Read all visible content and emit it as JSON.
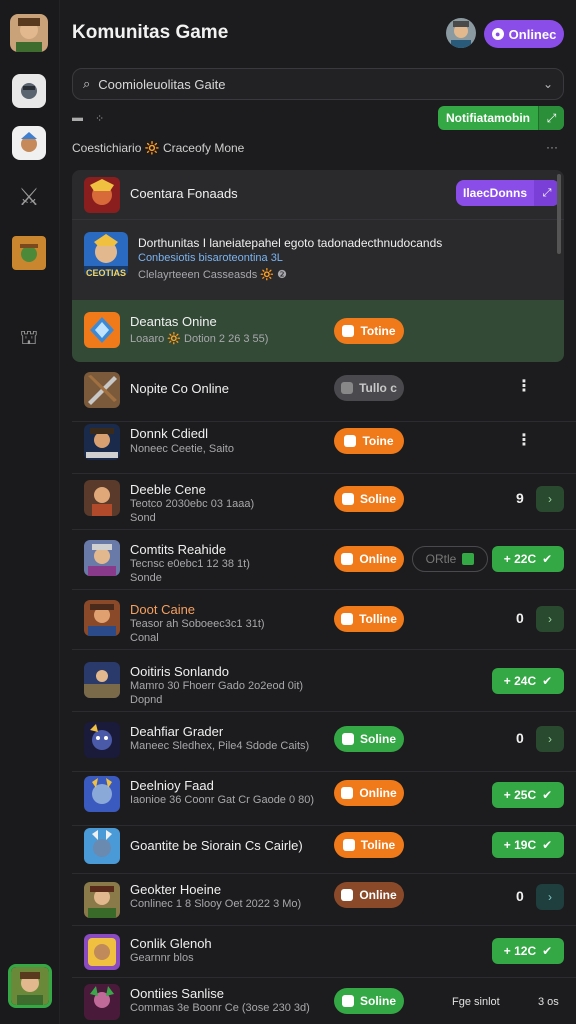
{
  "header": {
    "title": "Komunitas Game",
    "online_label": "Onlinec"
  },
  "search": {
    "value": "Coomioleuolitas Gaite"
  },
  "notif_button": {
    "label": "Notifiatamobin",
    "icon": "expand-icon"
  },
  "section": {
    "label": "Coestichiario 🔆 Craceofy Mone",
    "more": "···"
  },
  "panel": {
    "row1": {
      "title": "Coentara Fonaads",
      "button": "IlaecDonns"
    },
    "row2": {
      "title": "Dorthunitas  I laneiatepahel egoto tadonadecthnudocands",
      "line2": "Conbesiotis  bisaroteontina 3L",
      "line3": "Clelayrteeen Casseasds 🔆 ❷",
      "badge": "CEOTIAS"
    },
    "row3": {
      "title": "Deantas Onine",
      "sub": "Loaaro 🔆 Dotion 2 26 3 55)",
      "pill": "Totine"
    }
  },
  "rows": [
    {
      "title": "Nopite Co Online",
      "sub": "",
      "sub2": "",
      "pill": "Tullo c",
      "pill_style": "grey",
      "right": "dots"
    },
    {
      "title": "Donnk Cdiedl",
      "sub": "Noneec Ceetie, Saito",
      "sub2": "",
      "pill": "Toine",
      "pill_style": "orange",
      "right": "dots"
    },
    {
      "title": "Deeble Cene",
      "sub": "Teotco 2030ebc 03 1aaa)",
      "sub2": "Sond",
      "pill": "Soline",
      "pill_style": "orange",
      "right": "count",
      "count": "9"
    },
    {
      "title": "Comtits Reahide",
      "sub": "Tecnsc e0ebc1 12 38 1t)",
      "sub2": "Sonde",
      "pill": "Online",
      "pill_style": "orange",
      "outline_pill": "ORtle",
      "gain": "+ 22C"
    },
    {
      "title": "Doot Caine",
      "sub": "Teasor ah Soboeec3c1 31t)",
      "sub2": "Conal",
      "pill": "Tolline",
      "pill_style": "orange",
      "right": "count",
      "count": "0"
    },
    {
      "title": "Ooitiris Sonlando",
      "sub": "Mamro 30 Fhoerr Gado 2o2eod 0it)",
      "sub2": "Dopnd",
      "pill": "",
      "pill_style": "",
      "gain": "+ 24C"
    },
    {
      "title": "Deahfiar Grader",
      "sub": "Maneec Sledhex, Pile4 Sdode Caits)",
      "sub2": "",
      "pill": "Soline",
      "pill_style": "green",
      "right": "count",
      "count": "0"
    },
    {
      "title": "Deelnioy Faad",
      "sub": "Iaonioe 36 Coonr Gat Cr Gaode 0 80)",
      "sub2": "",
      "pill": "Online",
      "pill_style": "orange",
      "gain": "+ 25C"
    },
    {
      "title": "Goantite be Siorain Cs Cairle)",
      "sub": "",
      "sub2": "",
      "pill": "Toline",
      "pill_style": "orange",
      "gain": "+ 19C"
    },
    {
      "title": "Geokter Hoeine",
      "sub": "Conlinec 1 8 Slooy Oet 2022 3 Mo)",
      "sub2": "",
      "pill": "Online",
      "pill_style": "brown",
      "right": "count",
      "count": "0",
      "teal": true
    },
    {
      "title": "Conlik Glenoh",
      "sub": "Gearnnr blos",
      "sub2": "",
      "pill": "",
      "pill_style": "",
      "gain": "+ 12C"
    },
    {
      "title": "Oontiies Sanlise",
      "sub": "Commas 3e Boonr Ce (3ose 230 3d)",
      "sub2": "",
      "pill": "Soline",
      "pill_style": "green",
      "footer": "Fge sinlot",
      "footer2": "3 os"
    }
  ]
}
